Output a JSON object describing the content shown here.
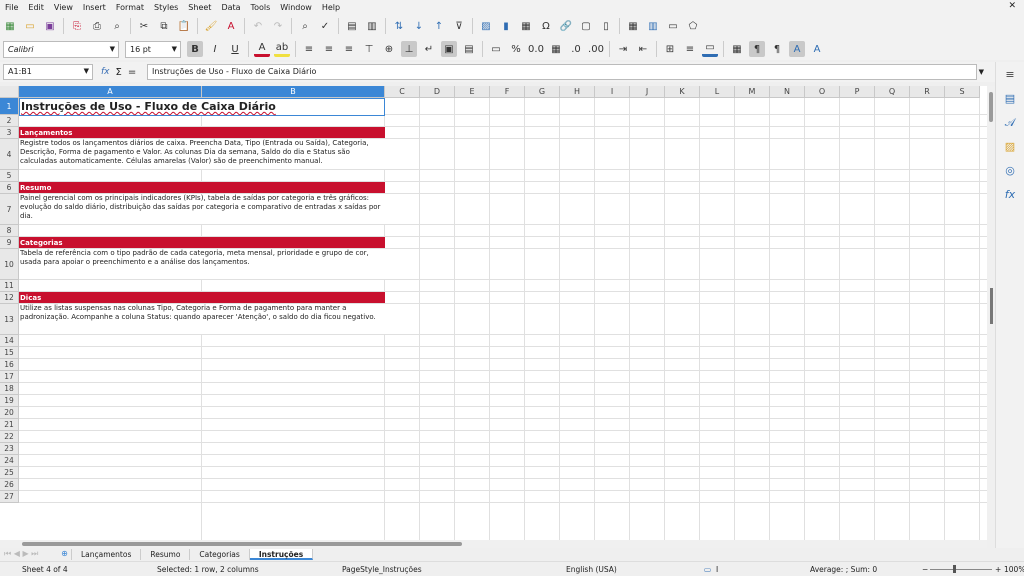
{
  "menu": [
    "File",
    "Edit",
    "View",
    "Insert",
    "Format",
    "Styles",
    "Sheet",
    "Data",
    "Tools",
    "Window",
    "Help"
  ],
  "formatting": {
    "font_name": "Calibri",
    "font_size": "16 pt"
  },
  "formula_bar": {
    "cell_ref": "A1:B1",
    "content": "Instruções de Uso - Fluxo de Caixa Diário",
    "fx": "fx",
    "sum": "Σ",
    "equals": "="
  },
  "columns": [
    "A",
    "B",
    "C",
    "D",
    "E",
    "F",
    "G",
    "H",
    "I",
    "J",
    "K",
    "L",
    "M",
    "N",
    "O",
    "P",
    "Q",
    "R",
    "S"
  ],
  "rows": [
    "1",
    "2",
    "3",
    "4",
    "5",
    "6",
    "7",
    "8",
    "9",
    "10",
    "11",
    "12",
    "13",
    "14",
    "15",
    "16",
    "17",
    "18",
    "19",
    "20",
    "21",
    "22",
    "23",
    "24",
    "25",
    "26",
    "27"
  ],
  "sheet": {
    "title": "Instruções de Uso - Fluxo de Caixa Diário",
    "sections": [
      {
        "header": "Lançamentos",
        "text": "Registre todos os lançamentos diários de caixa. Preencha Data, Tipo (Entrada ou Saída), Categoria, Descrição, Forma de pagamento e Valor. As colunas Dia da semana, Saldo do dia e Status são calculadas automaticamente. Células amarelas (Valor) são de preenchimento manual."
      },
      {
        "header": "Resumo",
        "text": "Painel gerencial com os principais indicadores (KPIs), tabela de saídas por categoria e três gráficos: evolução do saldo diário, distribuição das saídas por categoria e comparativo de entradas x saídas por dia."
      },
      {
        "header": "Categorias",
        "text": "Tabela de referência com o tipo padrão de cada categoria, meta mensal, prioridade e grupo de cor, usada para apoiar o preenchimento e a análise dos lançamentos."
      },
      {
        "header": "Dicas",
        "text": "Utilize as listas suspensas nas colunas Tipo, Categoria e Forma de pagamento para manter a padronização. Acompanhe a coluna Status: quando aparecer 'Atenção', o saldo do dia ficou negativo."
      }
    ]
  },
  "tabs": {
    "add": "⊕",
    "items": [
      "Lançamentos",
      "Resumo",
      "Categorias",
      "Instruções"
    ],
    "active": "Instruções"
  },
  "status": {
    "sheet": "Sheet 4 of 4",
    "selection": "Selected: 1 row, 2 columns",
    "page_style": "PageStyle_Instruções",
    "language": "English (USA)",
    "summary": "Average: ; Sum: 0",
    "zoom": "100%"
  },
  "colors": {
    "accent": "#3b87d6",
    "section_header": "#c8102e"
  }
}
